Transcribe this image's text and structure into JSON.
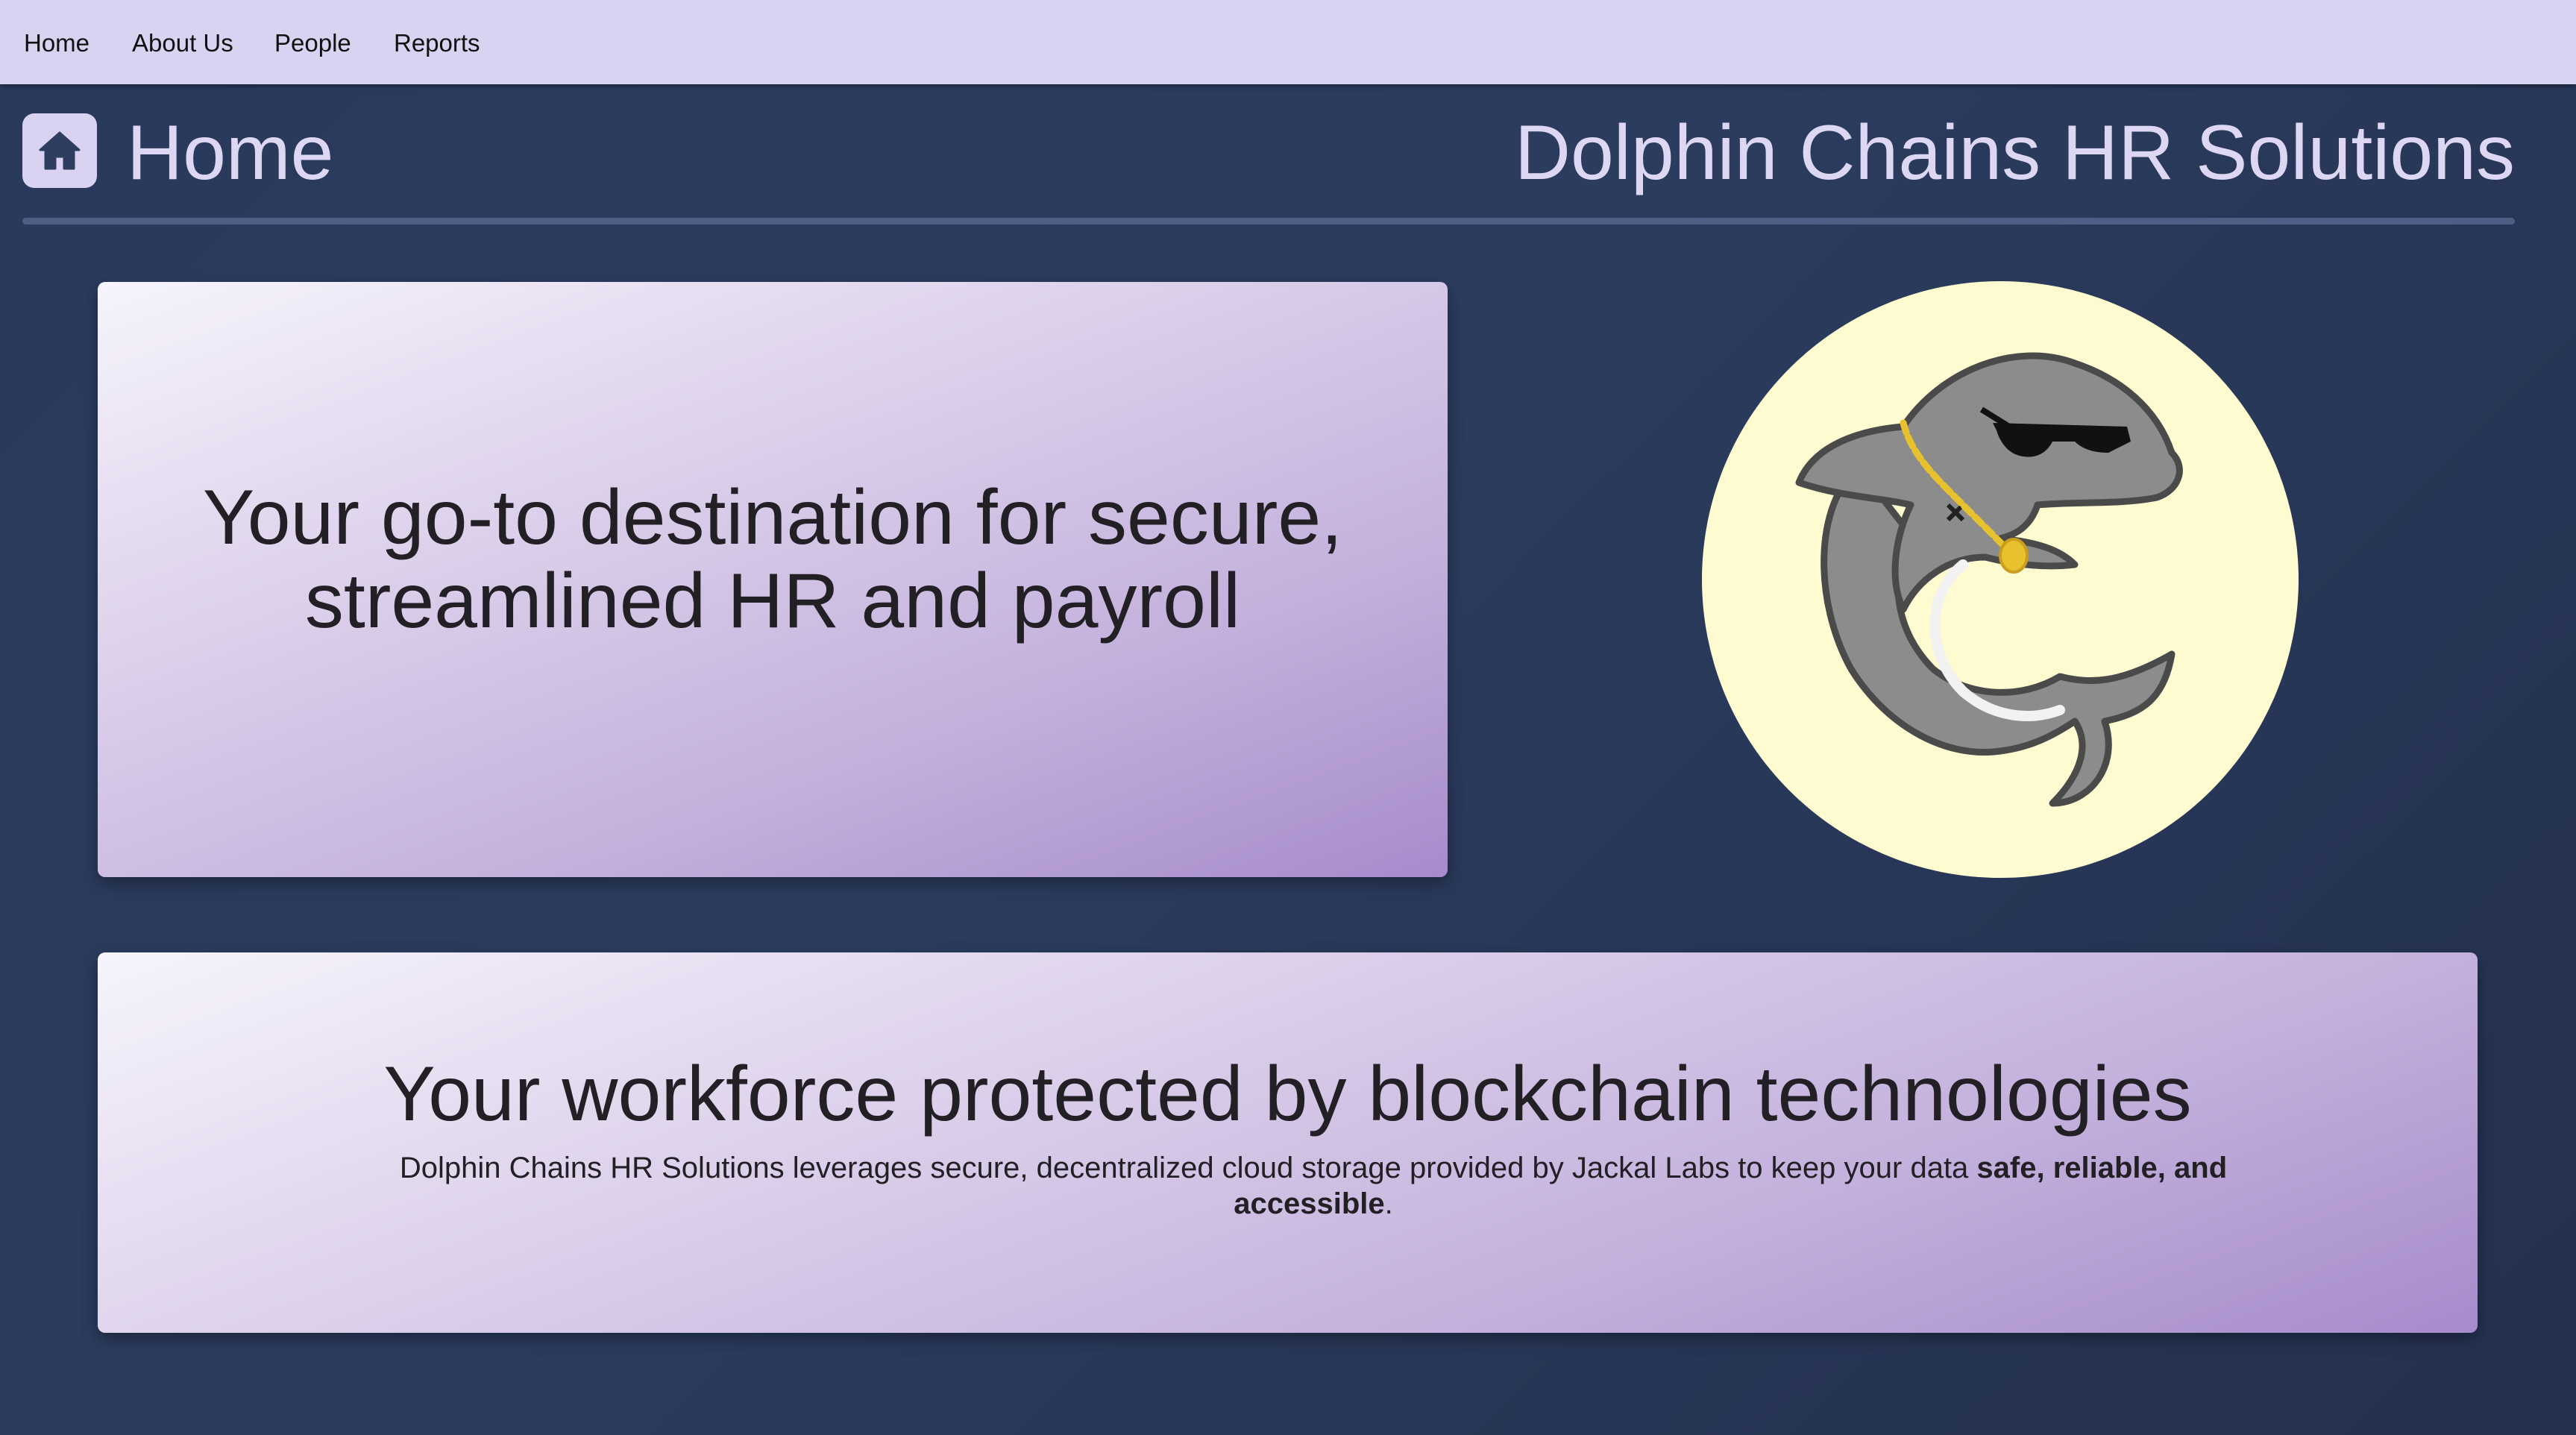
{
  "nav": {
    "items": [
      {
        "label": "Home"
      },
      {
        "label": "About Us"
      },
      {
        "label": "People"
      },
      {
        "label": "Reports"
      }
    ]
  },
  "header": {
    "page_title": "Home",
    "brand": "Dolphin Chains HR Solutions",
    "icon": "home-icon"
  },
  "hero": {
    "text": "Your go-to destination for secure, streamlined HR and payroll"
  },
  "logo": {
    "icon": "dolphin-logo-icon"
  },
  "info": {
    "heading": "Your workforce protected by blockchain technologies",
    "body_prefix": "Dolphin Chains HR Solutions leverages secure, decentralized cloud storage provided by Jackal Labs to keep your data ",
    "body_bold": "safe, reliable, and accessible",
    "body_suffix": "."
  },
  "colors": {
    "nav_bg": "#d9d3f1",
    "page_bg": "#2a3a5c",
    "title_text": "#ddd7f3",
    "logo_bg": "#fffbd0",
    "card_light": "#f6f4fc",
    "card_dark": "#a68bcb"
  }
}
